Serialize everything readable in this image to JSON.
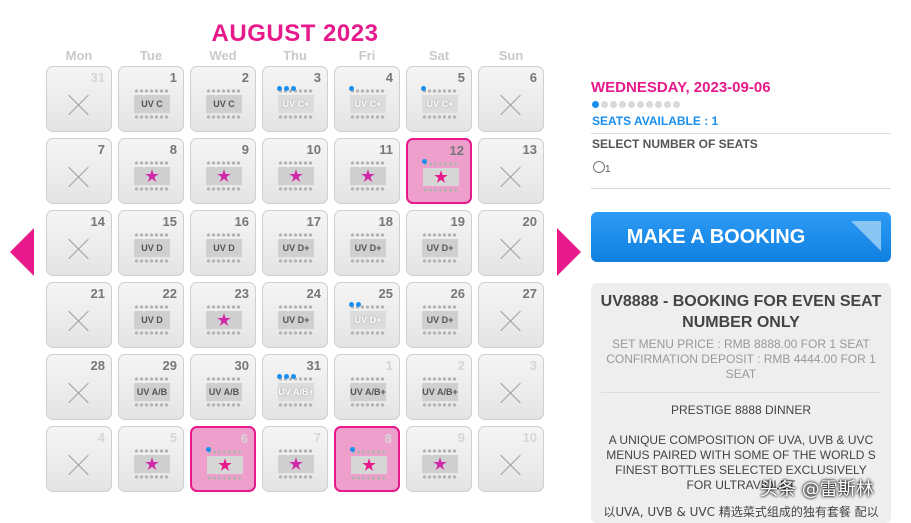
{
  "calendar": {
    "month_title": "AUGUST 2023",
    "weekdays": [
      "Mon",
      "Tue",
      "Wed",
      "Thu",
      "Fri",
      "Sat",
      "Sun"
    ],
    "weeks": [
      [
        {
          "day": "31",
          "other": true,
          "type": "x"
        },
        {
          "day": "1",
          "type": "seat",
          "label": "UV C"
        },
        {
          "day": "2",
          "type": "seat",
          "label": "UV C"
        },
        {
          "day": "3",
          "type": "seat",
          "label": "UV C+",
          "avail": true,
          "blue": 3
        },
        {
          "day": "4",
          "type": "seat",
          "label": "UV C+",
          "avail": true,
          "blue": 1
        },
        {
          "day": "5",
          "type": "seat",
          "label": "UV C+",
          "avail": true,
          "blue": 1
        },
        {
          "day": "6",
          "type": "x"
        }
      ],
      [
        {
          "day": "7",
          "type": "x"
        },
        {
          "day": "8",
          "type": "star"
        },
        {
          "day": "9",
          "type": "star"
        },
        {
          "day": "10",
          "type": "star"
        },
        {
          "day": "11",
          "type": "star"
        },
        {
          "day": "12",
          "type": "star",
          "selected": true,
          "blue": 1
        },
        {
          "day": "13",
          "type": "x"
        }
      ],
      [
        {
          "day": "14",
          "type": "x"
        },
        {
          "day": "15",
          "type": "seat",
          "label": "UV D"
        },
        {
          "day": "16",
          "type": "seat",
          "label": "UV D"
        },
        {
          "day": "17",
          "type": "seat",
          "label": "UV D+"
        },
        {
          "day": "18",
          "type": "seat",
          "label": "UV D+"
        },
        {
          "day": "19",
          "type": "seat",
          "label": "UV D+"
        },
        {
          "day": "20",
          "type": "x"
        }
      ],
      [
        {
          "day": "21",
          "type": "x"
        },
        {
          "day": "22",
          "type": "seat",
          "label": "UV D"
        },
        {
          "day": "23",
          "type": "star"
        },
        {
          "day": "24",
          "type": "seat",
          "label": "UV D+"
        },
        {
          "day": "25",
          "type": "seat",
          "label": "UV D+",
          "avail": true,
          "blue": 2
        },
        {
          "day": "26",
          "type": "seat",
          "label": "UV D+"
        },
        {
          "day": "27",
          "type": "x"
        }
      ],
      [
        {
          "day": "28",
          "type": "x"
        },
        {
          "day": "29",
          "type": "seat",
          "label": "UV A/B"
        },
        {
          "day": "30",
          "type": "seat",
          "label": "UV A/B"
        },
        {
          "day": "31",
          "type": "seat",
          "label": "UV A/B+",
          "avail": true,
          "blue": 3
        },
        {
          "day": "1",
          "other": true,
          "type": "seat",
          "label": "UV A/B+"
        },
        {
          "day": "2",
          "other": true,
          "type": "seat",
          "label": "UV A/B+"
        },
        {
          "day": "3",
          "other": true,
          "type": "x"
        }
      ],
      [
        {
          "day": "4",
          "other": true,
          "type": "x"
        },
        {
          "day": "5",
          "other": true,
          "type": "star"
        },
        {
          "day": "6",
          "other": true,
          "type": "star",
          "selected": true,
          "blue": 1
        },
        {
          "day": "7",
          "other": true,
          "type": "star"
        },
        {
          "day": "8",
          "other": true,
          "type": "star",
          "selected": true,
          "blue": 1
        },
        {
          "day": "9",
          "other": true,
          "type": "star"
        },
        {
          "day": "10",
          "other": true,
          "type": "x"
        }
      ]
    ]
  },
  "booking": {
    "date_title": "WEDNESDAY, 2023-09-06",
    "seat_progress": {
      "selected": 1,
      "total": 10
    },
    "seats_available": "SEATS AVAILABLE : 1",
    "select_label": "SELECT NUMBER OF SEATS",
    "option_label": "1",
    "button_label": "MAKE A BOOKING"
  },
  "info": {
    "title": "UV8888 - BOOKING FOR EVEN SEAT NUMBER ONLY",
    "price_line": "SET MENU PRICE : RMB 8888.00 FOR 1 SEAT",
    "deposit_line": "CONFIRMATION DEPOSIT : RMB 4444.00 FOR 1 SEAT",
    "dinner_name": "PRESTIGE 8888 DINNER",
    "description": "A UNIQUE COMPOSITION OF UVA, UVB & UVC MENUS PAIRED WITH SOME OF THE WORLD S FINEST BOTTLES SELECTED EXCLUSIVELY FOR ULTRAVIOLET",
    "description_cn": "以UVA, UVB & UVC 精选菜式组成的独有套餐 配以"
  },
  "watermark": "头条 @雷斯林",
  "colors": {
    "accent": "#e8198b",
    "blue": "#1a8ff0"
  }
}
